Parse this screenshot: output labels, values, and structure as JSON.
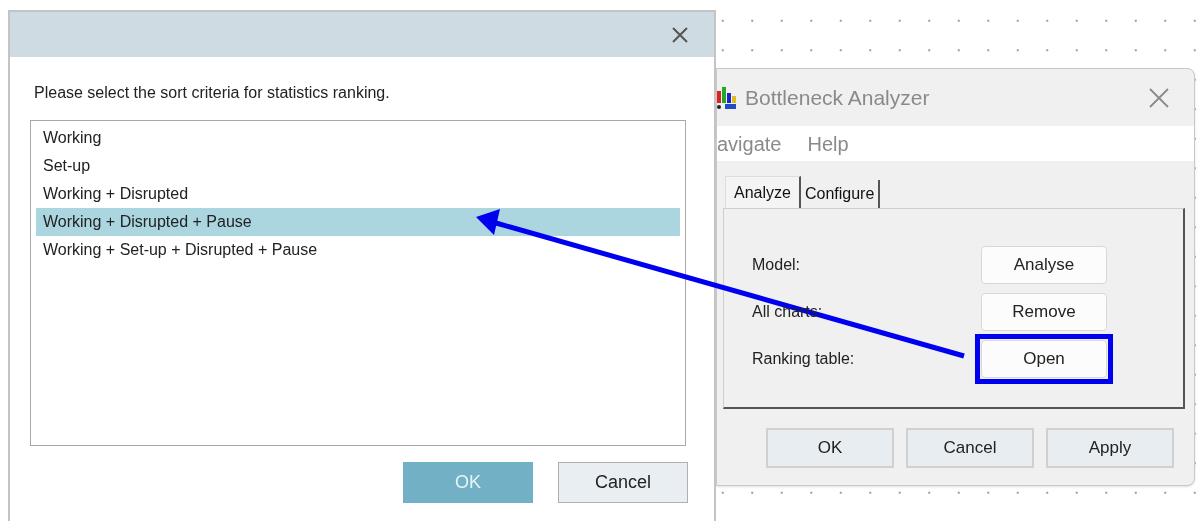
{
  "sort_dialog": {
    "prompt": "Please select the sort criteria for statistics ranking.",
    "options": [
      {
        "label": "Working",
        "selected": false
      },
      {
        "label": "Set-up",
        "selected": false
      },
      {
        "label": "Working + Disrupted",
        "selected": false
      },
      {
        "label": "Working + Disrupted + Pause",
        "selected": true
      },
      {
        "label": "Working + Set-up + Disrupted + Pause",
        "selected": false
      }
    ],
    "buttons": [
      {
        "label": "OK",
        "kind": "primary"
      },
      {
        "label": "Cancel",
        "kind": "secondary"
      }
    ]
  },
  "analyzer_window": {
    "title": "Bottleneck Analyzer",
    "menu": [
      "avigate",
      "Help"
    ],
    "tabs": [
      {
        "label": "Analyze",
        "selected": true
      },
      {
        "label": "Configure",
        "selected": false
      }
    ],
    "rows": [
      {
        "label": "Model:",
        "button": "Analyse",
        "highlighted": false
      },
      {
        "label": "All charts:",
        "button": "Remove",
        "highlighted": false
      },
      {
        "label": "Ranking table:",
        "button": "Open",
        "highlighted": true
      }
    ],
    "buttons": [
      "OK",
      "Cancel",
      "Apply"
    ]
  }
}
